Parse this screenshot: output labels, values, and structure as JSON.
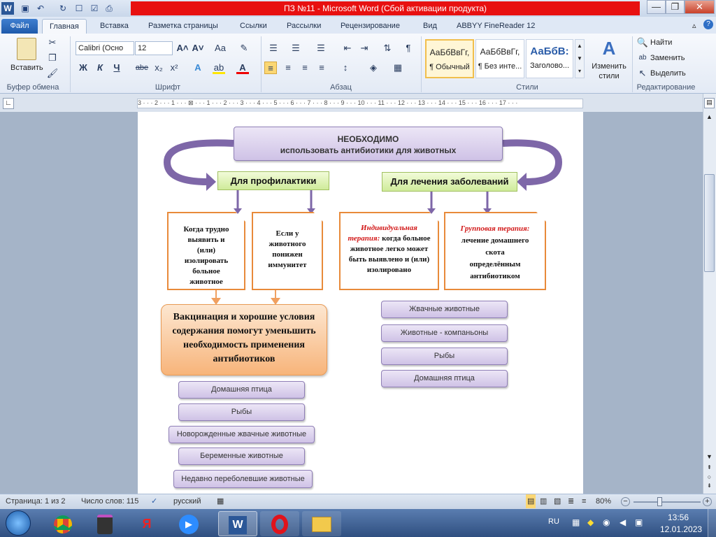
{
  "window": {
    "title": "ПЗ №11  -  Microsoft Word (Сбой активации продукта)",
    "app_icon": "W"
  },
  "tabs": [
    "Файл",
    "Главная",
    "Вставка",
    "Разметка страницы",
    "Ссылки",
    "Рассылки",
    "Рецензирование",
    "Вид",
    "ABBYY FineReader 12"
  ],
  "ribbon": {
    "clipboard": {
      "paste": "Вставить",
      "group": "Буфер обмена"
    },
    "font": {
      "name": "Calibri (Осно",
      "size": "12",
      "group": "Шрифт",
      "bold": "Ж",
      "italic": "К",
      "underline": "Ч",
      "strike": "abe",
      "sub": "x₂",
      "sup": "x²"
    },
    "paragraph": {
      "group": "Абзац"
    },
    "styles": {
      "group": "Стили",
      "items": [
        {
          "sample": "АаБбВвГг,",
          "name": "¶ Обычный"
        },
        {
          "sample": "АаБбВвГг,",
          "name": "¶ Без инте..."
        },
        {
          "sample": "АаБбВ:",
          "name": "Заголово..."
        }
      ],
      "change": "Изменить стили"
    },
    "editing": {
      "group": "Редактирование",
      "find": "Найти",
      "replace": "Заменить",
      "select": "Выделить"
    }
  },
  "ruler": "3 · · · 2 · · · 1 · · · ⊠ · · · 1 · · · 2 · · · 3 · · · 4 · · · 5 · · · 6 · · · 7 · · · 8 · · · 9 · · · 10 · · · 11 · · · 12 · · · 13 · · · 14 · · · 15 · · · 16 · · · 17 · · ·",
  "diagram": {
    "top": [
      "НЕОБХОДИМО",
      "использовать  антибиотики для животных"
    ],
    "left_head": "Для профилактики",
    "right_head": "Для лечения заболеваний",
    "box1": [
      "Когда трудно",
      "выявить и",
      "(или)",
      "изолировать",
      "больное",
      "животное"
    ],
    "box2": [
      "Если у",
      "животного",
      "понижен",
      "иммунитет"
    ],
    "box3_red": "Индивидуальная терапия:",
    "box3": "когда больное животное легко может быть выявлено и (или) изолировано",
    "box4_red": "Групповая терапия:",
    "box4": [
      "лечение домашнего",
      "скота",
      "определённым",
      "антибиотиком"
    ],
    "vaccine": "Вакцинация и хорошие условия содержания помогут уменьшить необходимость применения антибиотиков",
    "left_list": [
      "Домашняя птица",
      "Рыбы",
      "Новорожденные жвачные животные",
      "Беременные животные",
      "Недавно переболевшие животные"
    ],
    "right_list": [
      "Жвачные животные",
      "Животные - компаньоны",
      "Рыбы",
      "Домашняя птица"
    ]
  },
  "status": {
    "page": "Страница: 1 из 2",
    "words": "Число слов: 115",
    "lang": "русский",
    "zoom": "80%"
  },
  "taskbar": {
    "lang": "RU",
    "time": "13:56",
    "date": "12.01.2023"
  },
  "colors": {
    "title_red": "#e81010",
    "purple": "#7e67a8",
    "orange": "#e88a3a",
    "green": "#cfeb9a"
  }
}
